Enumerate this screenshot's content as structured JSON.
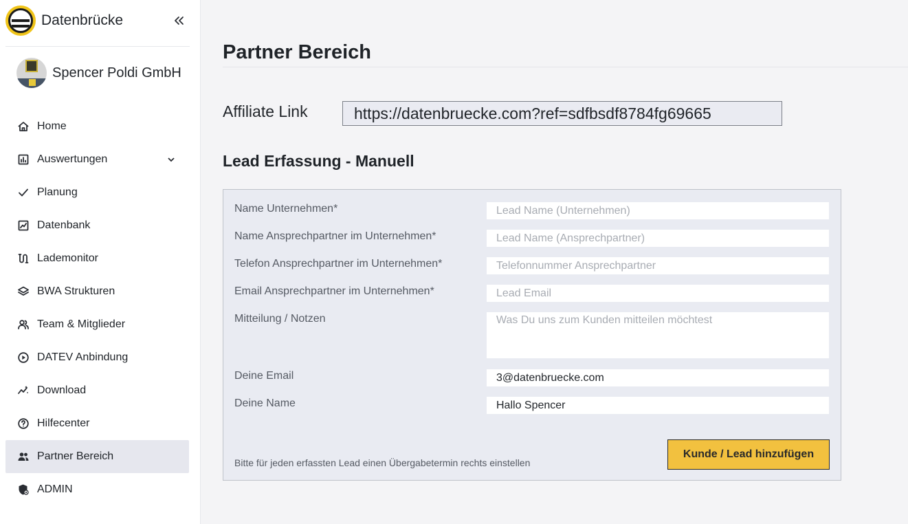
{
  "brand": {
    "name": "Datenbrücke"
  },
  "company": {
    "name": "Spencer Poldi GmbH"
  },
  "nav": {
    "items": [
      {
        "label": "Home",
        "icon": "home-icon"
      },
      {
        "label": "Auswertungen",
        "icon": "chart-icon",
        "expandable": true
      },
      {
        "label": "Planung",
        "icon": "check-icon"
      },
      {
        "label": "Datenbank",
        "icon": "line-chart-icon"
      },
      {
        "label": "Lademonitor",
        "icon": "route-icon"
      },
      {
        "label": "BWA Strukturen",
        "icon": "layers-icon"
      },
      {
        "label": "Team & Mitglieder",
        "icon": "people-icon"
      },
      {
        "label": "DATEV Anbindung",
        "icon": "play-circle-icon"
      },
      {
        "label": "Download",
        "icon": "sparkline-icon"
      },
      {
        "label": "Hilfecenter",
        "icon": "help-circle-icon"
      },
      {
        "label": "Partner Bereich",
        "icon": "people-icon",
        "active": true
      },
      {
        "label": "ADMIN",
        "icon": "shield-icon"
      }
    ]
  },
  "page": {
    "title": "Partner Bereich",
    "affiliate_label": "Affiliate Link",
    "affiliate_url": "https://datenbruecke.com?ref=sdfbsdf8784fg69665",
    "section_title": "Lead Erfassung - Manuell"
  },
  "form": {
    "company_name": {
      "label": "Name Unternehmen*",
      "placeholder": "Lead Name (Unternehmen)",
      "value": ""
    },
    "contact_name": {
      "label": "Name Ansprechpartner im Unternehmen*",
      "placeholder": "Lead Name (Ansprechpartner)",
      "value": ""
    },
    "contact_phone": {
      "label": "Telefon Ansprechpartner im Unternehmen*",
      "placeholder": "Telefonnummer Ansprechpartner",
      "value": ""
    },
    "contact_email": {
      "label": "Email Ansprechpartner im Unternehmen*",
      "placeholder": "Lead Email",
      "value": ""
    },
    "notes": {
      "label": "Mitteilung / Notzen",
      "placeholder": "Was Du uns zum Kunden mitteilen möchtest",
      "value": ""
    },
    "your_email": {
      "label": "Deine Email",
      "value": "3@datenbruecke.com"
    },
    "your_name": {
      "label": "Deine Name",
      "value": "Hallo Spencer"
    },
    "hint": "Bitte für jeden erfassten Lead einen Übergabetermin rechts einstellen",
    "submit_label": "Kunde / Lead hinzufügen"
  },
  "colors": {
    "accent": "#f2c13f",
    "active_nav_bg": "#e6e7ee",
    "form_bg": "#e9ebf2"
  }
}
